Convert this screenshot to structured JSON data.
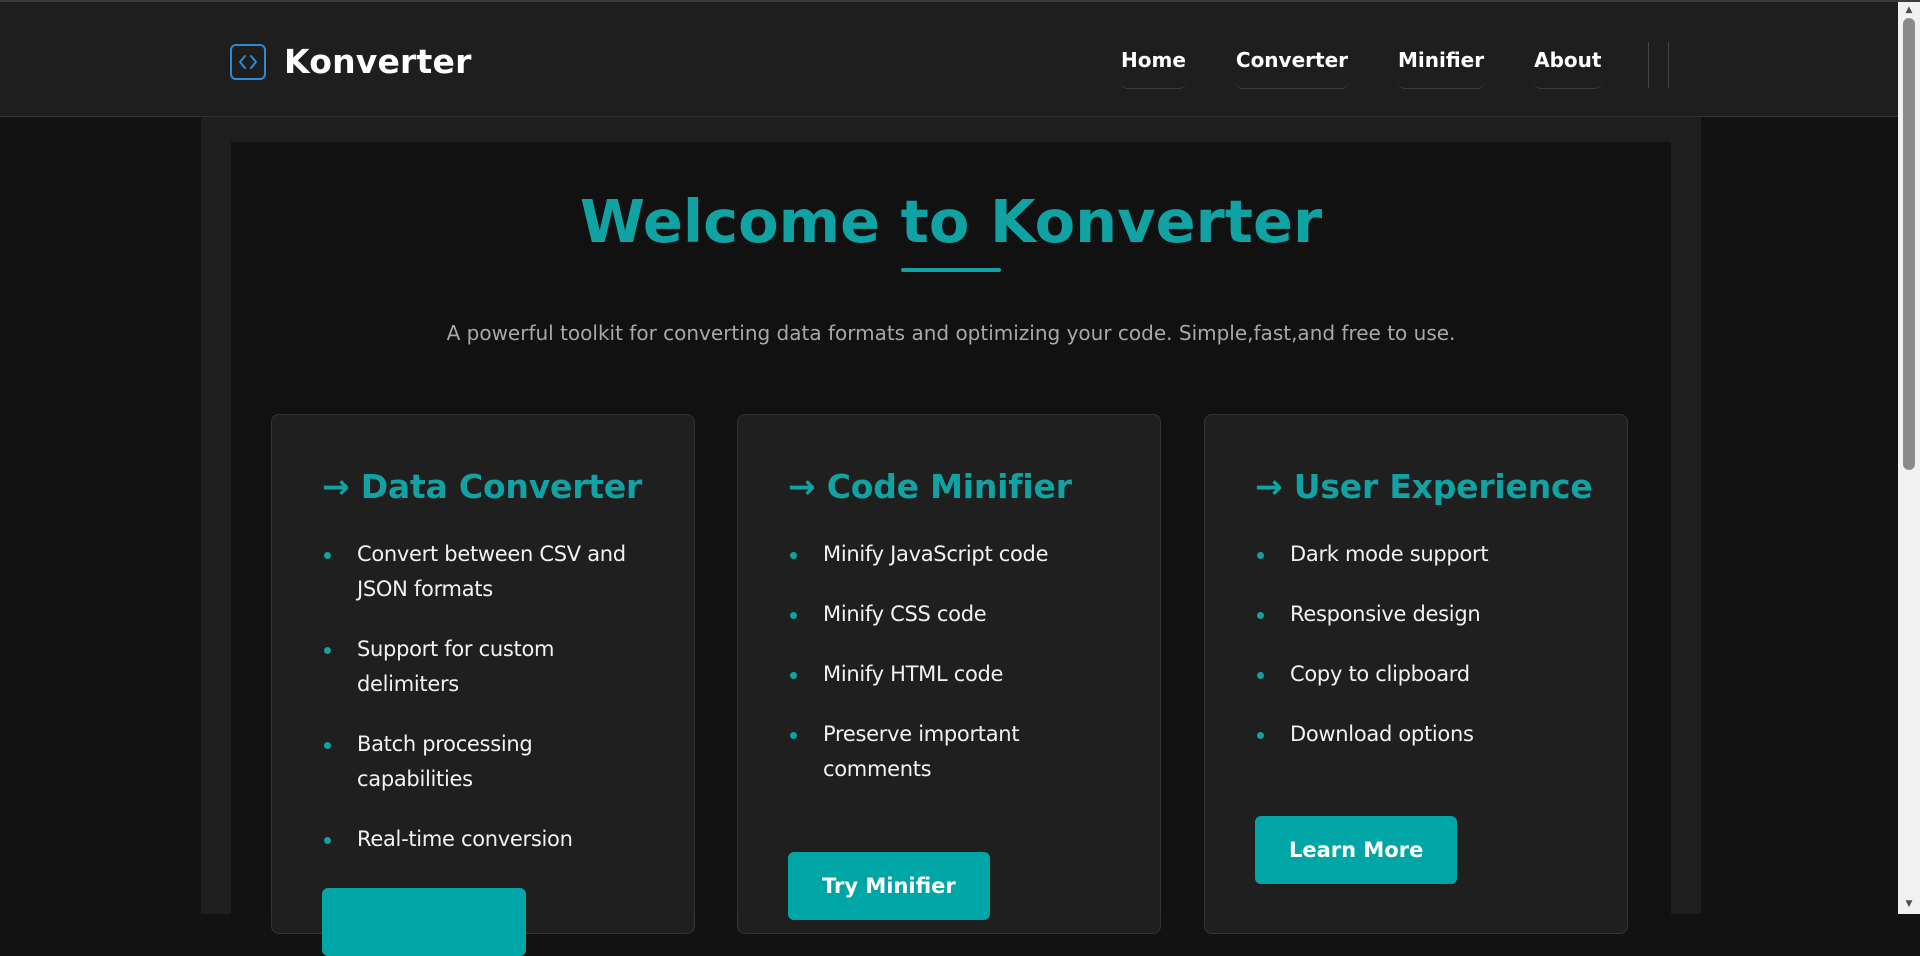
{
  "header": {
    "brand": "Konverter",
    "nav": [
      {
        "label": "Home"
      },
      {
        "label": "Converter"
      },
      {
        "label": "Minifier"
      },
      {
        "label": "About"
      }
    ]
  },
  "hero": {
    "title": "Welcome to Konverter",
    "subtitle": "A powerful toolkit for converting data formats and optimizing your code. Simple,fast,and free to use."
  },
  "cards": [
    {
      "title": "→ Data Converter",
      "items": [
        "Convert between CSV and JSON formats",
        "Support for custom delimiters",
        "Batch processing capabilities",
        "Real-time conversion"
      ],
      "button": ""
    },
    {
      "title": "→ Code Minifier",
      "items": [
        "Minify JavaScript code",
        "Minify CSS code",
        "Minify HTML code",
        "Preserve important comments"
      ],
      "button": "Try Minifier"
    },
    {
      "title": "→ User Experience",
      "items": [
        "Dark mode support",
        "Responsive design",
        "Copy to clipboard",
        "Download options"
      ],
      "button": "Learn More"
    }
  ],
  "icons": {
    "logo": "code-brackets-icon",
    "bullet": "dot-icon",
    "scroll_up": "arrow-up-icon",
    "scroll_down": "arrow-down-icon"
  },
  "colors": {
    "accent": "#11a3a3",
    "button": "#00a6a6",
    "background": "#121212",
    "header": "#1e1e1e",
    "card": "#1f1f1f",
    "logo": "#2d8ad6"
  }
}
